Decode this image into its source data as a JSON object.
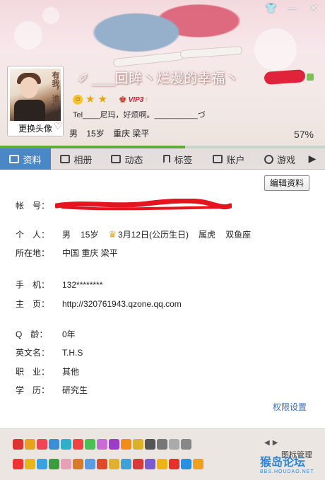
{
  "window": {
    "controls": [
      {
        "name": "skin-icon",
        "glyph": "👕"
      },
      {
        "name": "minimize-icon",
        "glyph": "—"
      },
      {
        "name": "close-icon",
        "glyph": "✕"
      }
    ]
  },
  "profile": {
    "avatar_vertical_text": "有我，谁叶",
    "change_avatar": "更换头像",
    "nickname": "___回眸丶烂漫的幸福丶",
    "nickname_icon": "feather-icon",
    "signature": "Tel____尼玛，好烦啊。__________づ",
    "vip": "VIP3",
    "gender": "男",
    "age": "15岁",
    "location": "重庆 梁平",
    "completion_percent": "57%",
    "completion_value": 57
  },
  "tabs": [
    {
      "label": "资料",
      "icon": "profile-card-icon",
      "active": true
    },
    {
      "label": "相册",
      "icon": "photo-album-icon",
      "active": false
    },
    {
      "label": "动态",
      "icon": "feed-icon",
      "active": false
    },
    {
      "label": "标签",
      "icon": "tag-icon",
      "active": false
    },
    {
      "label": "账户",
      "icon": "account-icon",
      "active": false
    },
    {
      "label": "游戏",
      "icon": "game-icon",
      "active": false
    }
  ],
  "tabs_more": "▶",
  "edit_button": "编辑资料",
  "details": {
    "account": {
      "label": "帐　号："
    },
    "person": {
      "label": "个　人：",
      "gender": "男",
      "age": "15岁",
      "birthday": "3月12日(公历生日)",
      "zodiac": "属虎",
      "constellation": "双鱼座"
    },
    "location": {
      "label": "所在地：",
      "value": "中国 重庆 梁平"
    },
    "phone": {
      "label": "手　机：",
      "value": "132********"
    },
    "homepage": {
      "label": "主　页：",
      "value": "http://320761943.qzone.qq.com"
    },
    "qage": {
      "label": "Q　龄：",
      "value": "0年"
    },
    "english_name": {
      "label": "英文名：",
      "value": "T.H.S"
    },
    "job": {
      "label": "职　业：",
      "value": "其他"
    },
    "education": {
      "label": "学　历：",
      "value": "研究生"
    }
  },
  "permissions_link": "权限设置",
  "footer": {
    "manage_icons": "图标管理",
    "arrows": [
      "◀",
      "▶"
    ],
    "watermark": "猴岛论坛",
    "watermark_url": "BBS.HOUDAO.NET"
  }
}
